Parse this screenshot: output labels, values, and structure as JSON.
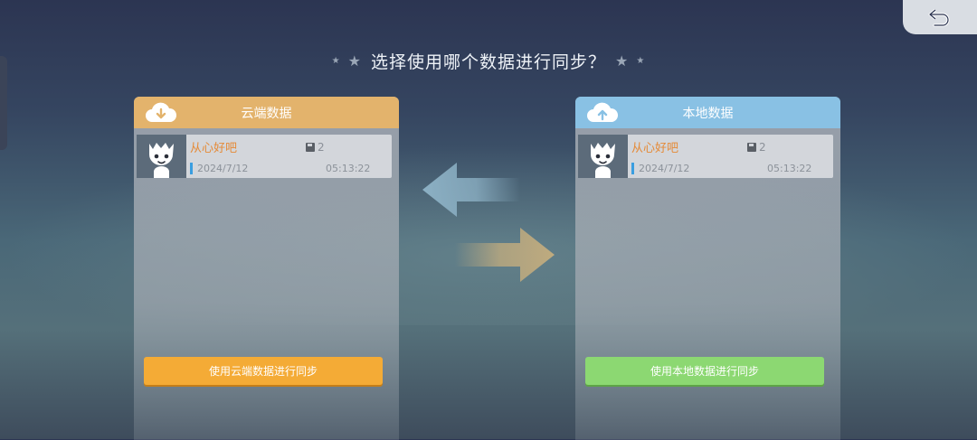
{
  "title": "选择使用哪个数据进行同步？",
  "cloud_panel": {
    "header": "云端数据",
    "icon": "cloud-download-icon",
    "accent": "#e3b36c",
    "save": {
      "name": "从心好吧",
      "count": "2",
      "date": "2024/7/12",
      "time": "05:13:22"
    },
    "button": "使用云端数据进行同步",
    "button_color": "#f4ab36"
  },
  "local_panel": {
    "header": "本地数据",
    "icon": "cloud-upload-icon",
    "accent": "#89c1e4",
    "save": {
      "name": "从心好吧",
      "count": "2",
      "date": "2024/7/12",
      "time": "05:13:22"
    },
    "button": "使用本地数据进行同步",
    "button_color": "#8cd872"
  },
  "icons": {
    "back": "back-icon",
    "arrow_left": "arrow-left-icon",
    "arrow_right": "arrow-right-icon",
    "star": "star-icon"
  }
}
